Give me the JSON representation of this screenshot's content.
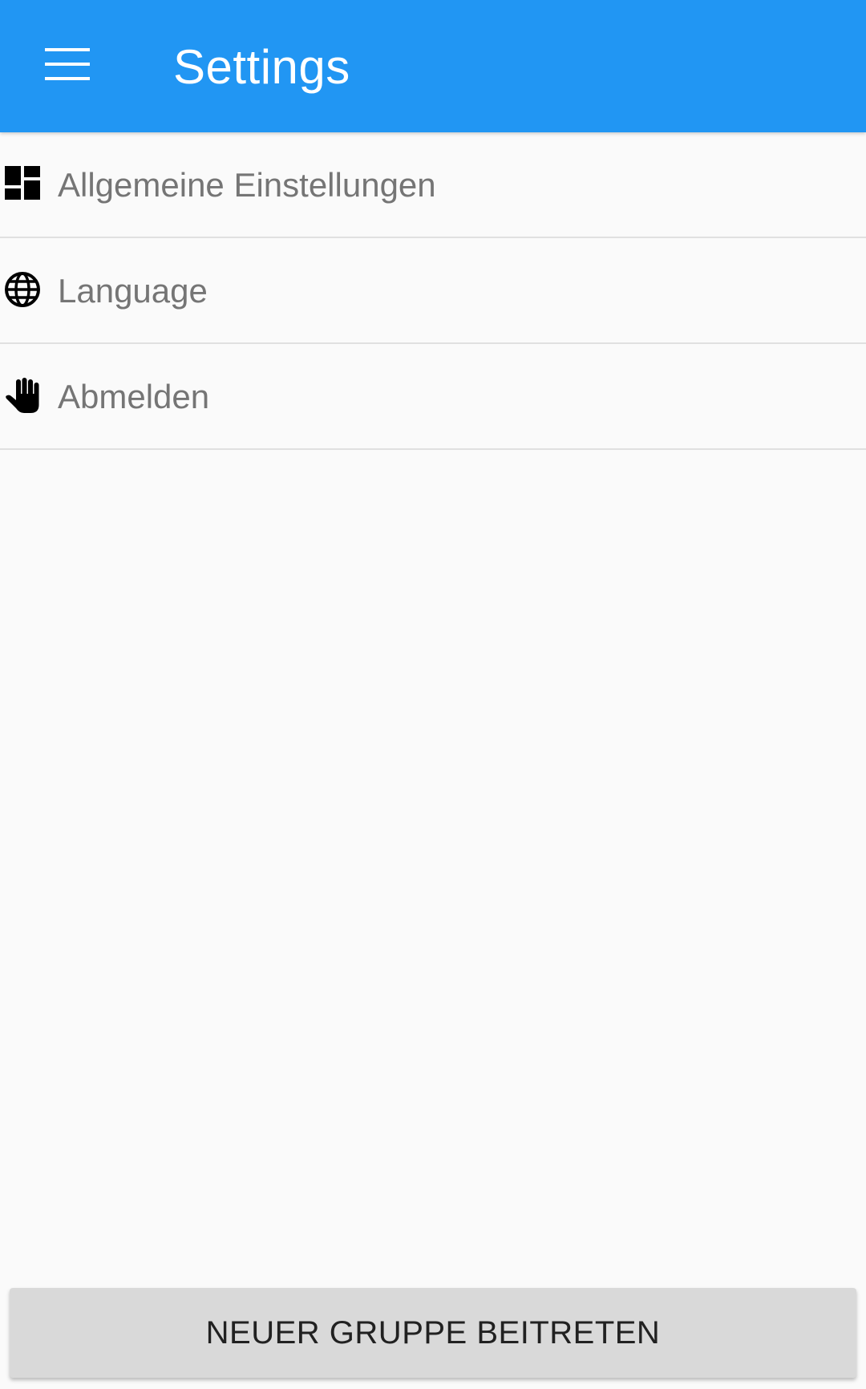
{
  "app_bar": {
    "title": "Settings",
    "menu_icon": "hamburger-menu-icon",
    "background_color": "#2196F3"
  },
  "settings_list": {
    "items": [
      {
        "label": "Allgemeine Einstellungen",
        "icon": "dashboard-icon"
      },
      {
        "label": "Language",
        "icon": "globe-icon"
      },
      {
        "label": "Abmelden",
        "icon": "hand-stop-icon"
      }
    ]
  },
  "footer": {
    "join_group_label": "NEUER GRUPPE BEITRETEN"
  }
}
